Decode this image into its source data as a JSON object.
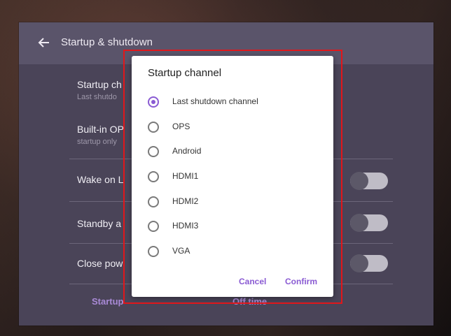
{
  "header": {
    "title": "Startup & shutdown"
  },
  "rows": [
    {
      "title": "Startup ch",
      "subtitle": "Last shutdo"
    },
    {
      "title": "Built-in OP",
      "subtitle": "startup only"
    },
    {
      "title": "Wake on L",
      "toggle": false
    },
    {
      "title": "Standby a",
      "toggle": false
    },
    {
      "title": "Close pow",
      "toggle": false
    }
  ],
  "footer": {
    "startup_label": "Startup",
    "offtime_label": "Off time"
  },
  "dialog": {
    "title": "Startup channel",
    "options": [
      {
        "label": "Last shutdown channel",
        "selected": true
      },
      {
        "label": "OPS",
        "selected": false
      },
      {
        "label": "Android",
        "selected": false
      },
      {
        "label": "HDMI1",
        "selected": false
      },
      {
        "label": "HDMI2",
        "selected": false
      },
      {
        "label": "HDMI3",
        "selected": false
      },
      {
        "label": "VGA",
        "selected": false
      }
    ],
    "cancel_label": "Cancel",
    "confirm_label": "Confirm"
  },
  "colors": {
    "accent": "#8a5bd3",
    "highlight_box": "#e0171b",
    "panel": "#4a4458"
  },
  "icons": {
    "back": "arrow-left-icon"
  }
}
